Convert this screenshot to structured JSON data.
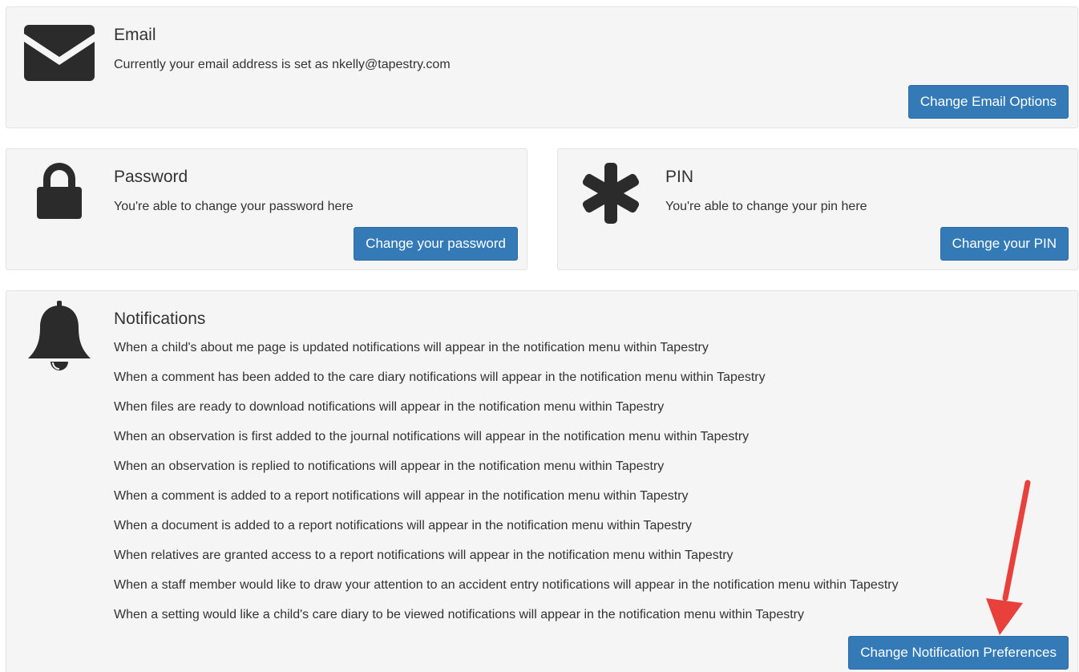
{
  "email": {
    "title": "Email",
    "description": "Currently your email address is set as nkelly@tapestry.com",
    "button_label": "Change Email Options",
    "icon": "envelope-icon"
  },
  "password": {
    "title": "Password",
    "description": "You're able to change your password here",
    "button_label": "Change your password",
    "icon": "lock-icon"
  },
  "pin": {
    "title": "PIN",
    "description": "You're able to change your pin here",
    "button_label": "Change your PIN",
    "icon": "asterisk-icon"
  },
  "notifications": {
    "title": "Notifications",
    "icon": "bell-icon",
    "items": [
      "When a child's about me page is updated notifications will appear in the notification menu within Tapestry",
      "When a comment has been added to the care diary notifications will appear in the notification menu within Tapestry",
      "When files are ready to download notifications will appear in the notification menu within Tapestry",
      "When an observation is first added to the journal notifications will appear in the notification menu within Tapestry",
      "When an observation is replied to notifications will appear in the notification menu within Tapestry",
      "When a comment is added to a report notifications will appear in the notification menu within Tapestry",
      "When a document is added to a report notifications will appear in the notification menu within Tapestry",
      "When relatives are granted access to a report notifications will appear in the notification menu within Tapestry",
      "When a staff member would like to draw your attention to an accident entry notifications will appear in the notification menu within Tapestry",
      "When a setting would like a child's care diary to be viewed notifications will appear in the notification menu within Tapestry"
    ],
    "button_label": "Change Notification Preferences"
  },
  "colors": {
    "button": "#337ab7",
    "panel": "#f5f5f5",
    "annotation_arrow": "#e8403a",
    "icon": "#2b2b2b"
  }
}
